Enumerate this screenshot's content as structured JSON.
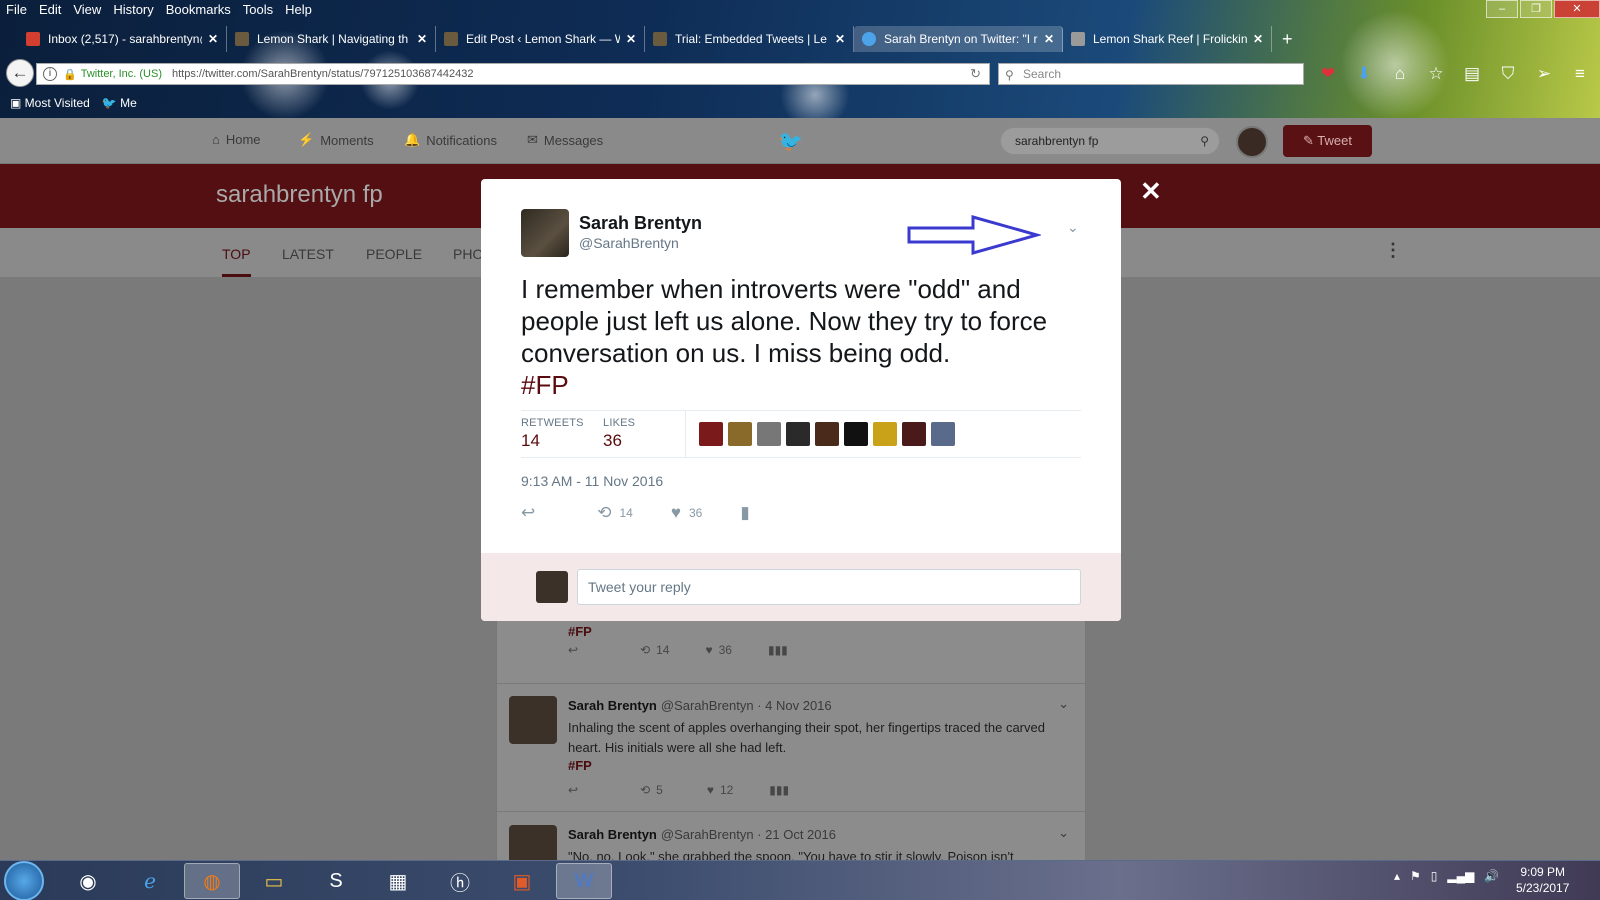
{
  "menubar": [
    "File",
    "Edit",
    "View",
    "History",
    "Bookmarks",
    "Tools",
    "Help"
  ],
  "window_buttons": {
    "minimize": "–",
    "restore": "❐",
    "close": "✕"
  },
  "tabs": [
    {
      "title": "Inbox (2,517) - sarahbrentyn@",
      "icon": "gmail-icon",
      "color": "#d23f31",
      "active": false
    },
    {
      "title": "Lemon Shark | Navigating th",
      "icon": "lemon-shark-icon",
      "color": "#6b5b3e",
      "active": false
    },
    {
      "title": "Edit Post ‹ Lemon Shark — W",
      "icon": "lemon-shark-icon",
      "color": "#6b5b3e",
      "active": false
    },
    {
      "title": "Trial: Embedded Tweets | Le",
      "icon": "lemon-shark-icon",
      "color": "#6b5b3e",
      "active": false
    },
    {
      "title": "Sarah Brentyn on Twitter: \"I r",
      "icon": "twitter-icon",
      "color": "#4da3ea",
      "active": true
    },
    {
      "title": "Lemon Shark Reef | Frolicking",
      "icon": "reef-icon",
      "color": "#9a9a9a",
      "active": false
    }
  ],
  "urlbar": {
    "org": "Twitter, Inc. (US)",
    "url": "https://twitter.com/SarahBrentyn/status/797125103687442432"
  },
  "search": {
    "placeholder": "Search"
  },
  "bookmarks": [
    "Most Visited",
    "Me"
  ],
  "twitter_nav": {
    "items": [
      {
        "label": "Home",
        "icon": "home-icon"
      },
      {
        "label": "Moments",
        "icon": "lightning-icon"
      },
      {
        "label": "Notifications",
        "icon": "bell-icon"
      },
      {
        "label": "Messages",
        "icon": "envelope-icon"
      }
    ],
    "search_value": "sarahbrentyn fp",
    "tweet_button": "Tweet"
  },
  "banner_title": "sarahbrentyn fp",
  "subnav": [
    "TOP",
    "LATEST",
    "PEOPLE",
    "PHO"
  ],
  "modal": {
    "name": "Sarah Brentyn",
    "handle": "@SarahBrentyn",
    "text": "I remember when introverts were \"odd\" and people just left us alone. Now they try to force conversation on us. I miss being odd.",
    "hashtag": "#FP",
    "retweets_label": "RETWEETS",
    "retweets": "14",
    "likes_label": "LIKES",
    "likes": "36",
    "timestamp": "9:13 AM - 11 Nov 2016",
    "action_retweets": "14",
    "action_likes": "36",
    "reply_placeholder": "Tweet your reply",
    "liker_colors": [
      "#7a1a1a",
      "#8a6a2a",
      "#777777",
      "#2a2a2a",
      "#4a2a1a",
      "#111111",
      "#c9a21a",
      "#4a1a1a",
      "#5a6a8a"
    ]
  },
  "feed": {
    "partial": {
      "hashtag": "#FP",
      "retweets": "14",
      "likes": "36"
    },
    "items": [
      {
        "name": "Sarah Brentyn",
        "handle": "@SarahBrentyn",
        "date": "4 Nov 2016",
        "text": "Inhaling the scent of apples overhanging their spot, her fingertips traced the carved heart. His initials were all she had left.",
        "hashtag": "#FP",
        "retweets": "5",
        "likes": "12"
      },
      {
        "name": "Sarah Brentyn",
        "handle": "@SarahBrentyn",
        "date": "21 Oct 2016",
        "text": "\"No, no. Look,\" she grabbed the spoon. \"You have to stir it slowly. Poison isn't",
        "hashtag": "",
        "retweets": "",
        "likes": ""
      }
    ]
  },
  "taskbar": {
    "time": "9:09 PM",
    "date": "5/23/2017"
  }
}
